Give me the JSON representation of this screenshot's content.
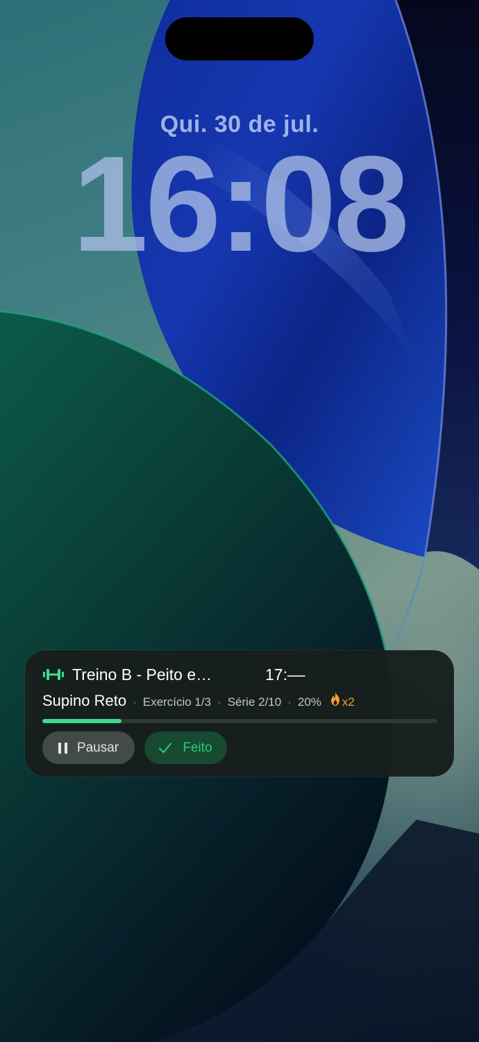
{
  "lockscreen": {
    "date": "Qui. 30 de jul.",
    "time": "16:08"
  },
  "activity": {
    "title": "Treino B - Peito e…",
    "timer": "17:––",
    "exercise": "Supino Reto",
    "exercise_count": "Exercício 1/3",
    "set_count": "Série 2/10",
    "percent": "20%",
    "streak": "x2",
    "separator": "·",
    "progress": 0.2,
    "pause_label": "Pausar",
    "done_label": "Feito",
    "icons": {
      "title": "dumbbell-icon",
      "streak": "fire-icon",
      "pause": "pause-icon",
      "done": "checkmark-icon"
    },
    "colors": {
      "accent": "#3ddc8c",
      "streak": "#f1a227",
      "card": "#181f1e"
    }
  }
}
